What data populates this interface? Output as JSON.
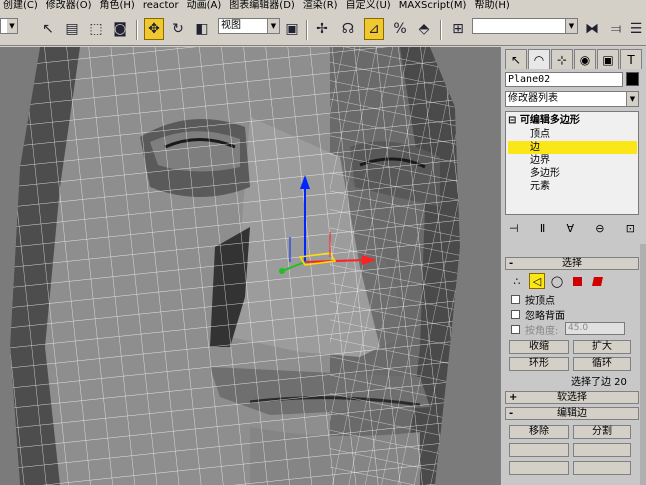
{
  "menu": [
    "创建(C)",
    "修改器(O)",
    "角色(H)",
    "reactor",
    "动画(A)",
    "图表编辑器(D)",
    "渲染(R)",
    "自定义(U)",
    "MAXScript(M)",
    "帮助(H)"
  ],
  "toolbar": {
    "view_combo": "视图"
  },
  "panel": {
    "object_name": "Plane02",
    "modifier_list_label": "修改器列表",
    "stack": {
      "root": "可编辑多边形",
      "items": [
        "顶点",
        "边",
        "边界",
        "多边形",
        "元素"
      ],
      "selected_index": 1
    },
    "selection": {
      "title": "选择",
      "by_vertex": "按顶点",
      "ignore_backfacing": "忽略背面",
      "by_angle": "按角度:",
      "angle_value": "45.0",
      "shrink": "收缩",
      "grow": "扩大",
      "ring": "环形",
      "loop": "循环",
      "status": "选择了边 20"
    },
    "soft_selection": {
      "title": "软选择"
    },
    "edit_edges": {
      "title": "编辑边",
      "remove": "移除",
      "split": "分割"
    }
  },
  "colors": {
    "active_highlight": "#fbe718",
    "viewport_bg": "#7b7b7b",
    "mesh_dark": "#4a4a4a",
    "mesh_light": "#8e8e8e",
    "wire": "#ffffff"
  }
}
